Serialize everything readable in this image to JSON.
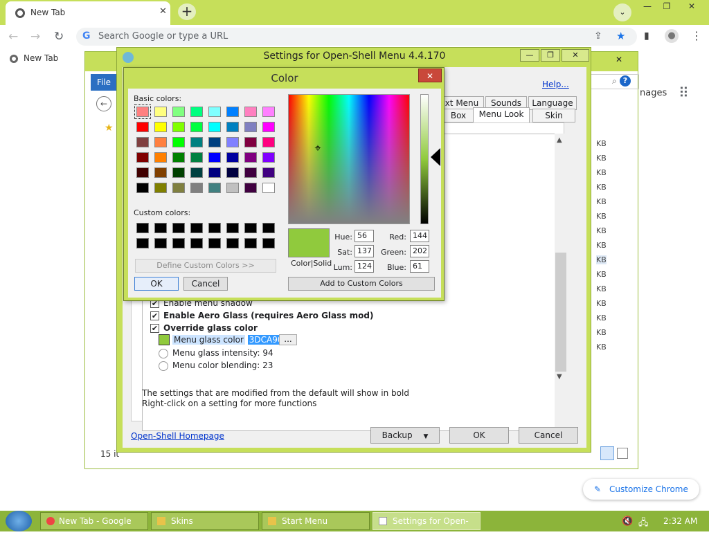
{
  "chrome": {
    "tab_title": "New Tab",
    "tab_close": "✕",
    "new_tab": "+",
    "tab_search": "⌄",
    "min": "—",
    "restore": "❐",
    "close": "✕",
    "back": "←",
    "forward": "→",
    "reload": "↻",
    "omnibox_placeholder": "Search Google or type a URL",
    "share": "⇪",
    "star": "★",
    "sidepanel": "▮",
    "profile": "●",
    "menu": "⋮",
    "bookmark_newtab": "New Tab",
    "images_link": "nages",
    "apps": "⠿",
    "customize": "Customize Chrome",
    "accent": "#c6df5a"
  },
  "explorer": {
    "file_tab": "File",
    "close": "✕",
    "kb_label": "KB",
    "status": "15 it"
  },
  "settings": {
    "title": "Settings for Open-Shell Menu 4.4.170",
    "help": "Help...",
    "tabs_row1": [
      "xt Menu",
      "Sounds",
      "Language"
    ],
    "tabs_row2": [
      "Box",
      "Menu Look",
      "Skin"
    ],
    "options": [
      {
        "label": "Enable menu shadow",
        "checked": true,
        "bold": false
      },
      {
        "label": "Enable Aero Glass (requires Aero Glass mod)",
        "checked": true,
        "bold": true
      },
      {
        "label": "Override glass color",
        "checked": true,
        "bold": true
      }
    ],
    "glass_color_label": "Menu glass color",
    "glass_color_value": "3DCA90",
    "ellipsis": "...",
    "intensity": "Menu glass intensity: 94",
    "blending": "Menu color blending: 23",
    "note1": "The settings that are modified from the default will show in bold",
    "note2": "Right-click on a setting for more functions",
    "homepage": "Open-Shell Homepage",
    "backup": "Backup",
    "ok": "OK",
    "cancel": "Cancel"
  },
  "color_dialog": {
    "title": "Color",
    "close": "✕",
    "basic_label": "Basic colors:",
    "custom_label": "Custom colors:",
    "basic_colors": [
      "#ff8080",
      "#ffff80",
      "#80ff80",
      "#00ff80",
      "#80ffff",
      "#0080ff",
      "#ff80c0",
      "#ff80ff",
      "#ff0000",
      "#ffff00",
      "#80ff00",
      "#00ff40",
      "#00ffff",
      "#0080c0",
      "#8080c0",
      "#ff00ff",
      "#804040",
      "#ff8040",
      "#00ff00",
      "#008080",
      "#004080",
      "#8080ff",
      "#800040",
      "#ff0080",
      "#800000",
      "#ff8000",
      "#008000",
      "#008040",
      "#0000ff",
      "#0000a0",
      "#800080",
      "#8000ff",
      "#400000",
      "#804000",
      "#004000",
      "#004040",
      "#000080",
      "#000040",
      "#400040",
      "#400080",
      "#000000",
      "#808000",
      "#808040",
      "#808080",
      "#408080",
      "#c0c0c0",
      "#400040",
      "#ffffff"
    ],
    "define_custom": "Define Custom Colors >>",
    "ok": "OK",
    "cancel": "Cancel",
    "color_solid": "Color|Solid",
    "hue_label": "Hue:",
    "hue": "56",
    "sat_label": "Sat:",
    "sat": "137",
    "lum_label": "Lum:",
    "lum": "124",
    "red_label": "Red:",
    "red": "144",
    "green_label": "Green:",
    "green": "202",
    "blue_label": "Blue:",
    "blue": "61",
    "add_custom": "Add to Custom Colors",
    "crosshair": "⌖"
  },
  "taskbar": {
    "items": [
      "New Tab - Google C...",
      "Skins",
      "Start Menu",
      "Settings for Open-Sh..."
    ],
    "time": "2:32 AM",
    "color": "#8cb43a"
  }
}
